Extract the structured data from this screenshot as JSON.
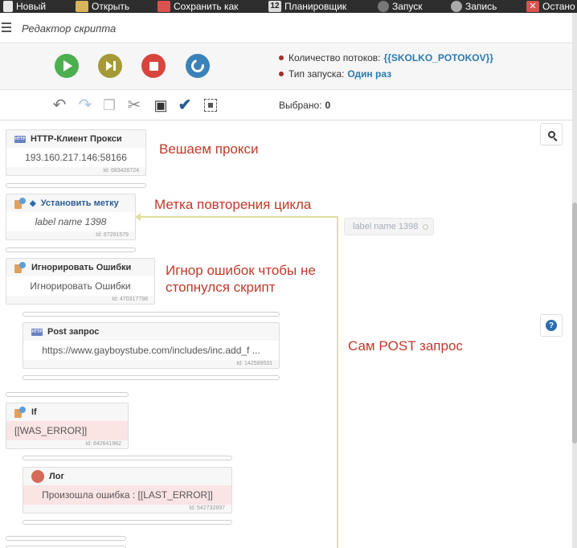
{
  "menubar": {
    "items": [
      {
        "label": "Новый",
        "icon": "new-file-icon"
      },
      {
        "label": "Открыть",
        "icon": "folder-icon"
      },
      {
        "label": "Сохранить как",
        "icon": "save-icon"
      },
      {
        "label": "Планировщик",
        "icon": "calendar-icon",
        "icon_text": "12"
      },
      {
        "label": "Запуск",
        "icon": "play-circle-icon"
      },
      {
        "label": "Запись",
        "icon": "record-icon"
      },
      {
        "label": "Остано",
        "icon": "stop-icon",
        "icon_text": "✕"
      }
    ]
  },
  "title": "Редактор скрипта",
  "info": {
    "threads_label": "Количество потоков:",
    "threads_value": "{{SKOLKO_POTOKOV}}",
    "launch_label": "Тип запуска:",
    "launch_value": "Один раз"
  },
  "toolbar": {
    "selected_label": "Выбрано:",
    "selected_count": "0"
  },
  "blocks": {
    "http_proxy": {
      "title": "HTTP-Клиент Прокси",
      "body": "193.160.217.146:58166",
      "id": "Id: 683428724",
      "icon_text": "HTTP"
    },
    "set_label": {
      "title": "Установить метку",
      "body": "label name 1398",
      "id": "Id: 67291579"
    },
    "ignore_errors": {
      "title": "Игнорировать Ошибки",
      "body": "Игнорировать Ошибки",
      "id": "Id: 470317798"
    },
    "post": {
      "title": "Post запрос",
      "body": "https://www.gayboystube.com/includes/inc.add_f ...",
      "id": "Id: 142589531",
      "icon_text": "HTTP"
    },
    "if": {
      "title": "If",
      "body": "[[WAS_ERROR]]",
      "id": "Id: 842641982"
    },
    "log": {
      "title": "Лог",
      "body": "Произошла ошибка : [[LAST_ERROR]]",
      "id": "Id: 542732897"
    }
  },
  "loop": {
    "label": "label name 1398"
  },
  "notes": {
    "proxy": "Вешаем прокси",
    "loop": "Метка повторения цикла",
    "ignore_1": "Игнор ошибок чтобы не",
    "ignore_2": "стопнулся скрипт",
    "post": "Сам POST запрос"
  },
  "help_icon": "?",
  "colors": {
    "accent_blue": "#2a7ab0",
    "note_red": "#c0392b",
    "run_green": "#4caf50",
    "stop_red": "#d9433d",
    "error_bg": "#fbe4e4",
    "loop_line": "#e0df9c"
  }
}
